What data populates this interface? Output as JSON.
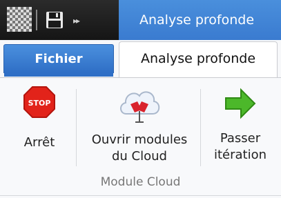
{
  "qat": {
    "app_icon": "checkerboard-app-icon",
    "save_icon": "floppy-disk-icon",
    "more_icon": "double-chevron-right-icon"
  },
  "window": {
    "title": "Analyse profonde"
  },
  "tabs": {
    "file": "Fichier",
    "active": "Analyse profonde"
  },
  "ribbon": {
    "group_label": "Module Cloud",
    "buttons": [
      {
        "label1": "Arrêt",
        "label2": "",
        "icon": "stop-sign-icon",
        "icon_text": "STOP",
        "color": "#e2231a"
      },
      {
        "label1": "Ouvrir modules",
        "label2": "du Cloud",
        "icon": "cloud-download-icon"
      },
      {
        "label1": "Passer",
        "label2": "itération",
        "icon": "green-arrow-right-icon",
        "color": "#4cb82a"
      }
    ]
  },
  "colors": {
    "title_blue": "#3a7bd0",
    "file_tab": "#2f6fc6"
  }
}
